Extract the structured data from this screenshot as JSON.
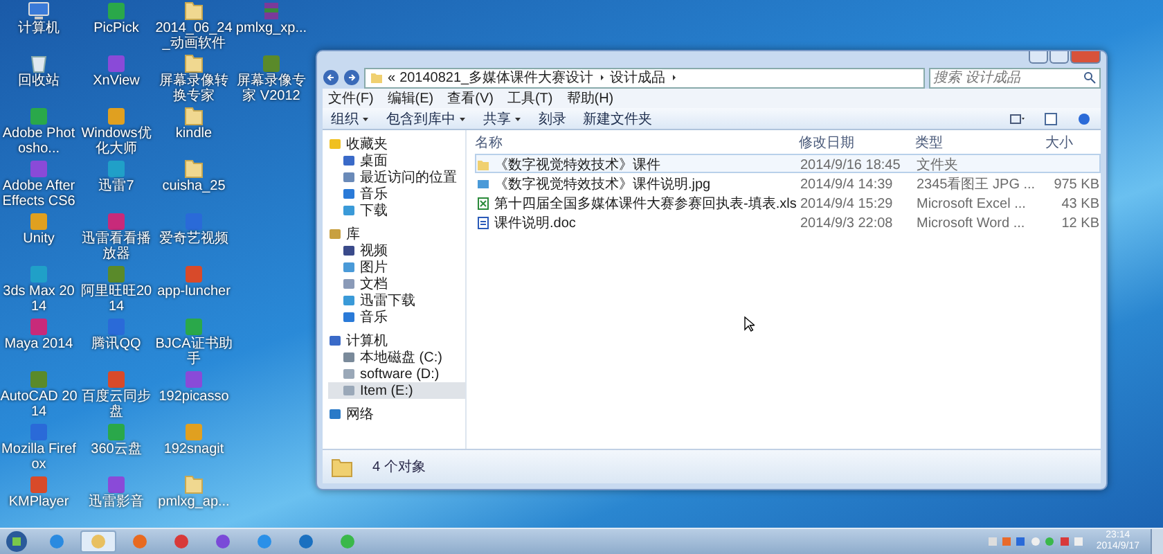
{
  "desktop": {
    "icons": [
      {
        "label": "计算机",
        "kind": "computer"
      },
      {
        "label": "回收站",
        "kind": "recycle-bin"
      },
      {
        "label": "Adobe Photosho...",
        "kind": "app"
      },
      {
        "label": "Adobe After Effects CS6",
        "kind": "app"
      },
      {
        "label": "Unity",
        "kind": "app"
      },
      {
        "label": "3ds Max 2014",
        "kind": "app"
      },
      {
        "label": "Maya 2014",
        "kind": "app"
      },
      {
        "label": "AutoCAD 2014",
        "kind": "app"
      },
      {
        "label": "Mozilla Firefox",
        "kind": "app"
      },
      {
        "label": "KMPlayer",
        "kind": "app"
      },
      {
        "label": "PicPick",
        "kind": "app"
      },
      {
        "label": "XnView",
        "kind": "app"
      },
      {
        "label": "Windows优化大师",
        "kind": "app"
      },
      {
        "label": "迅雷7",
        "kind": "app"
      },
      {
        "label": "迅雷看看播放器",
        "kind": "app"
      },
      {
        "label": "阿里旺旺2014",
        "kind": "app"
      },
      {
        "label": "腾讯QQ",
        "kind": "app"
      },
      {
        "label": "百度云同步盘",
        "kind": "app"
      },
      {
        "label": "360云盘",
        "kind": "app"
      },
      {
        "label": "迅雷影音",
        "kind": "app"
      },
      {
        "label": "2014_06_24_动画软件",
        "kind": "folder"
      },
      {
        "label": "屏幕录像转换专家",
        "kind": "folder"
      },
      {
        "label": "kindle",
        "kind": "folder"
      },
      {
        "label": "cuisha_25",
        "kind": "folder"
      },
      {
        "label": "爱奇艺视频",
        "kind": "app"
      },
      {
        "label": "app-luncher",
        "kind": "app"
      },
      {
        "label": "BJCA证书助手",
        "kind": "app"
      },
      {
        "label": "192picasso",
        "kind": "app"
      },
      {
        "label": "192snagit",
        "kind": "app"
      },
      {
        "label": "pmlxg_ap...",
        "kind": "folder"
      },
      {
        "label": "pmlxg_xp...",
        "kind": "archive"
      },
      {
        "label": "屏幕录像专家 V2012",
        "kind": "app"
      }
    ]
  },
  "explorer": {
    "address": {
      "prefix": "«",
      "crumbs": [
        "20140821_多媒体课件大赛设计",
        "设计成品"
      ]
    },
    "search": {
      "placeholder": "搜索 设计成品"
    },
    "menu": [
      "文件(F)",
      "编辑(E)",
      "查看(V)",
      "工具(T)",
      "帮助(H)"
    ],
    "toolbar": [
      {
        "label": "组织",
        "dropdown": true
      },
      {
        "label": "包含到库中",
        "dropdown": true
      },
      {
        "label": "共享",
        "dropdown": true
      },
      {
        "label": "刻录",
        "dropdown": false
      },
      {
        "label": "新建文件夹",
        "dropdown": false
      }
    ],
    "sidebar": [
      {
        "label": "收藏夹",
        "kind": "favorites",
        "items": [
          {
            "label": "桌面",
            "kind": "desktop",
            "selected": false
          },
          {
            "label": "最近访问的位置",
            "kind": "recent",
            "selected": false
          },
          {
            "label": "音乐",
            "kind": "music",
            "selected": false
          },
          {
            "label": "下载",
            "kind": "download",
            "selected": false
          }
        ]
      },
      {
        "label": "库",
        "kind": "library",
        "items": [
          {
            "label": "视频",
            "kind": "video",
            "selected": false
          },
          {
            "label": "图片",
            "kind": "picture",
            "selected": false
          },
          {
            "label": "文档",
            "kind": "document",
            "selected": false
          },
          {
            "label": "迅雷下载",
            "kind": "download",
            "selected": false
          },
          {
            "label": "音乐",
            "kind": "music",
            "selected": false
          }
        ]
      },
      {
        "label": "计算机",
        "kind": "computer",
        "items": [
          {
            "label": "本地磁盘 (C:)",
            "kind": "system-drive",
            "selected": false
          },
          {
            "label": "software (D:)",
            "kind": "drive",
            "selected": false
          },
          {
            "label": "Item (E:)",
            "kind": "drive",
            "selected": true
          }
        ]
      },
      {
        "label": "网络",
        "kind": "network"
      }
    ],
    "columns": [
      "名称",
      "修改日期",
      "类型",
      "大小"
    ],
    "files": [
      {
        "name": "《数字视觉特效技术》课件",
        "modified": "2014/9/16 18:45",
        "type": "文件夹",
        "kind": "folder",
        "selected": true
      },
      {
        "name": "《数字视觉特效技术》课件说明.jpg",
        "modified": "2014/9/4 14:39",
        "type": "2345看图王 JPG ...",
        "size": "975 KB",
        "kind": "image",
        "selected": false
      },
      {
        "name": "第十四届全国多媒体课件大赛参赛回执表-填表.xls",
        "modified": "2014/9/4 15:29",
        "type": "Microsoft Excel ...",
        "size": "43 KB",
        "kind": "excel",
        "selected": false
      },
      {
        "name": "课件说明.doc",
        "modified": "2014/9/3 22:08",
        "type": "Microsoft Word ...",
        "size": "12 KB",
        "kind": "word",
        "selected": false
      }
    ],
    "status": "4 个对象"
  },
  "taskbar": {
    "items": [
      {
        "kind": "ie",
        "selected": false
      },
      {
        "kind": "explorer",
        "selected": true
      },
      {
        "kind": "firefox",
        "selected": false
      },
      {
        "kind": "media",
        "selected": false
      },
      {
        "kind": "kmplayer",
        "selected": false
      },
      {
        "kind": "cloud",
        "selected": false
      },
      {
        "kind": "cloud-disk",
        "selected": false
      },
      {
        "kind": "player",
        "selected": false
      }
    ],
    "time": "23:14",
    "date": "2014/9/17"
  }
}
